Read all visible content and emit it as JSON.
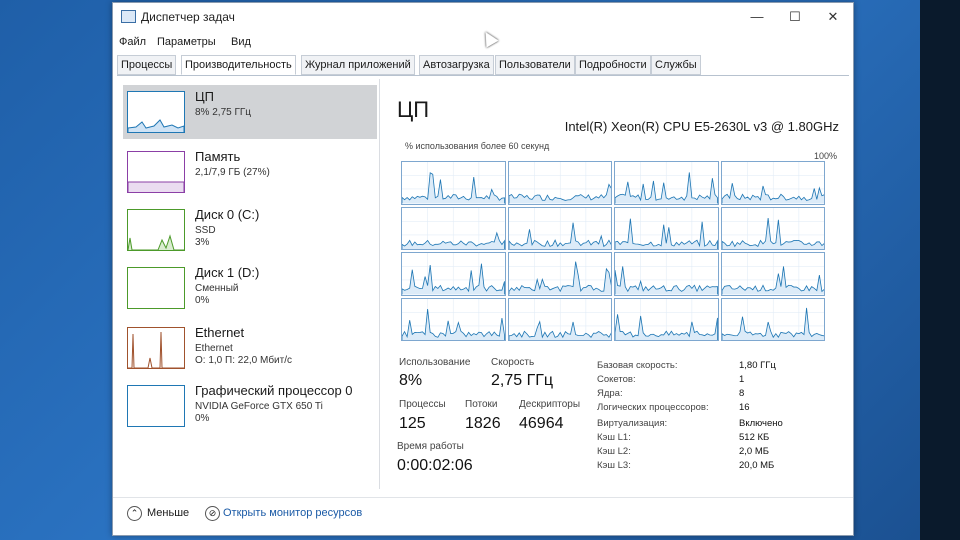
{
  "window": {
    "title": "Диспетчер задач",
    "controls": {
      "minimize": "—",
      "maximize": "☐",
      "close": "✕"
    }
  },
  "menu": [
    "Файл",
    "Параметры",
    "Вид"
  ],
  "tabs": [
    {
      "label": "Процессы",
      "active": false
    },
    {
      "label": "Производительность",
      "active": true
    },
    {
      "label": "Журнал приложений",
      "active": false
    },
    {
      "label": "Автозагрузка",
      "active": false
    },
    {
      "label": "Пользователи",
      "active": false
    },
    {
      "label": "Подробности",
      "active": false
    },
    {
      "label": "Службы",
      "active": false
    }
  ],
  "sidebar": [
    {
      "title": "ЦП",
      "line1": "8%  2,75 ГГц",
      "line2": "",
      "color": "#1f77b4",
      "selected": true
    },
    {
      "title": "Память",
      "line1": "2,1/7,9 ГБ (27%)",
      "line2": "",
      "color": "#8b3fa6",
      "selected": false
    },
    {
      "title": "Диск 0 (C:)",
      "line1": "SSD",
      "line2": "3%",
      "color": "#4c9a2a",
      "selected": false
    },
    {
      "title": "Диск 1 (D:)",
      "line1": "Сменный",
      "line2": "0%",
      "color": "#4c9a2a",
      "selected": false
    },
    {
      "title": "Ethernet",
      "line1": "Ethernet",
      "line2": "О: 1,0  П: 22,0 Мбит/с",
      "color": "#a0522d",
      "selected": false
    },
    {
      "title": "Графический процессор 0",
      "line1": "NVIDIA GeForce GTX 650 Ti",
      "line2": "0%",
      "color": "#1f77b4",
      "selected": false
    }
  ],
  "cpu": {
    "title": "ЦП",
    "model": "Intel(R) Xeon(R) CPU E5-2630L v3 @ 1.80GHz",
    "graph_caption": "% использования более 60 секунд",
    "graph_max": "100%",
    "usage_label": "Использование",
    "usage_value": "8%",
    "speed_label": "Скорость",
    "speed_value": "2,75 ГГц",
    "processes_label": "Процессы",
    "processes_value": "125",
    "threads_label": "Потоки",
    "threads_value": "1826",
    "handles_label": "Дескрипторы",
    "handles_value": "46964",
    "uptime_label": "Время работы",
    "uptime_value": "0:00:02:06",
    "details": [
      {
        "label": "Базовая скорость:",
        "value": "1,80 ГГц"
      },
      {
        "label": "Сокетов:",
        "value": "1"
      },
      {
        "label": "Ядра:",
        "value": "8"
      },
      {
        "label": "Логических процессоров:",
        "value": "16"
      },
      {
        "label": "Виртуализация:",
        "value": "Включено"
      },
      {
        "label": "Кэш L1:",
        "value": "512 КБ"
      },
      {
        "label": "Кэш L2:",
        "value": "2,0 МБ"
      },
      {
        "label": "Кэш L3:",
        "value": "20,0 МБ"
      }
    ]
  },
  "footer": {
    "less": "Меньше",
    "monitor": "Открыть монитор ресурсов"
  },
  "colors": {
    "accent": "#1f77b4",
    "grid": "#7ea7cf",
    "selected": "#d1d3d6"
  }
}
